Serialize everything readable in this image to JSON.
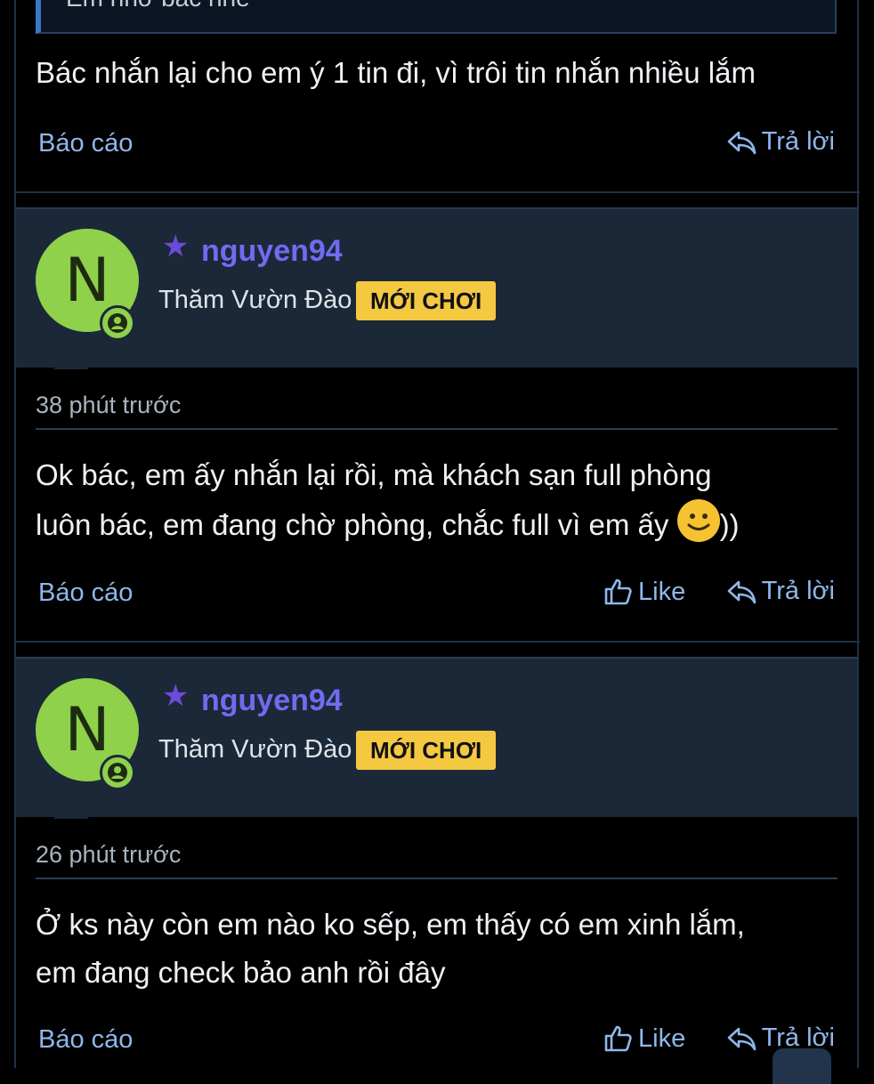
{
  "previous_post": {
    "quote_text": "Em nhớ bác nhé",
    "body": "Bác nhắn lại cho em ý 1 tin đi, vì trôi tin nhắn nhiều lắm",
    "report_label": "Báo cáo",
    "reply_label": "Trả lời"
  },
  "posts": [
    {
      "avatar_letter": "N",
      "username": "nguyen94",
      "user_title": "Thăm Vườn Đào",
      "rank_badge": "MỚI CHƠI",
      "time": "38 phút trước",
      "body_line1": "Ok bác, em ấy nhắn lại rồi, mà khách sạn full phòng",
      "body_line2a": "luôn bác, em đang chờ phòng, chắc full vì em ấy ",
      "body_line2b": "))",
      "report_label": "Báo cáo",
      "like_label": "Like",
      "reply_label": "Trả lời"
    },
    {
      "avatar_letter": "N",
      "username": "nguyen94",
      "user_title": "Thăm Vườn Đào",
      "rank_badge": "MỚI CHƠI",
      "time": "26 phút trước",
      "body_line1": "Ở ks này còn em nào ko sếp, em thấy có em xinh lắm,",
      "body_line2": "em đang check bảo anh rồi đây",
      "report_label": "Báo cáo",
      "like_label": "Like",
      "reply_label": "Trả lời"
    }
  ],
  "colors": {
    "link": "#8fb7ea",
    "username": "#6f6cf0",
    "badge": "#f5c842",
    "avatar": "#8fd14a",
    "header_bg": "#1b2838"
  },
  "icons": [
    "star-icon",
    "online-icon",
    "thumbs-up-icon",
    "reply-arrow-icon",
    "smile-emoji-icon"
  ]
}
